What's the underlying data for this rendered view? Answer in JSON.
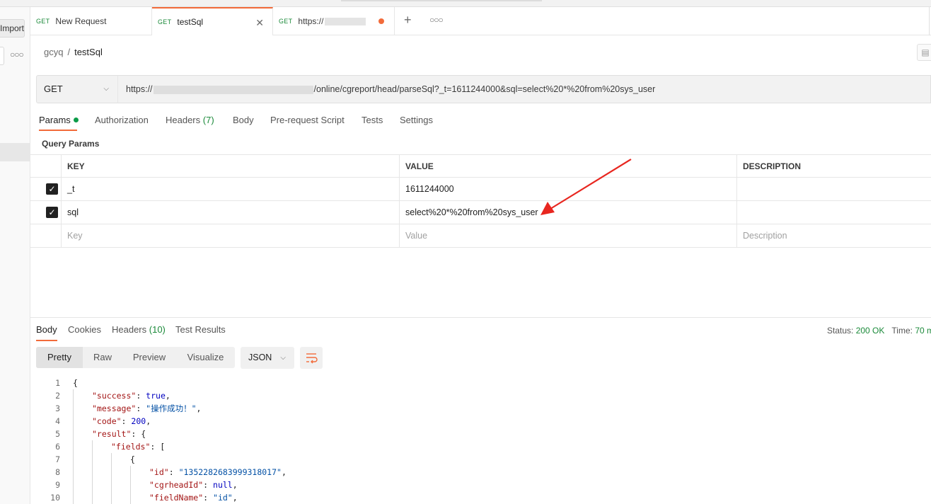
{
  "left_panel": {
    "import_label": "Import"
  },
  "tabs": [
    {
      "method": "GET",
      "label": "New Request"
    },
    {
      "method": "GET",
      "label": "testSql"
    },
    {
      "method": "GET",
      "label": "https://"
    }
  ],
  "breadcrumb": {
    "workspace": "gcyq",
    "separator": "/",
    "request": "testSql"
  },
  "request": {
    "method": "GET",
    "url_prefix": "https://",
    "url_suffix": "/online/cgreport/head/parseSql?_t=1611244000&sql=select%20*%20from%20sys_user"
  },
  "request_tabs": {
    "params": "Params",
    "authorization": "Authorization",
    "headers": "Headers",
    "headers_count": "(7)",
    "body": "Body",
    "pre_request": "Pre-request Script",
    "tests": "Tests",
    "settings": "Settings"
  },
  "query_params": {
    "title": "Query Params",
    "columns": {
      "key": "KEY",
      "value": "VALUE",
      "description": "DESCRIPTION"
    },
    "rows": [
      {
        "key": "_t",
        "value": "1611244000",
        "checked": true
      },
      {
        "key": "sql",
        "value": "select%20*%20from%20sys_user",
        "checked": true
      }
    ],
    "placeholders": {
      "key": "Key",
      "value": "Value",
      "description": "Description"
    }
  },
  "response_tabs": {
    "body": "Body",
    "cookies": "Cookies",
    "headers": "Headers",
    "headers_count": "(10)",
    "test_results": "Test Results"
  },
  "status": {
    "label": "Status:",
    "code": "200 OK",
    "time_label": "Time:",
    "time": "70 m"
  },
  "view_modes": [
    "Pretty",
    "Raw",
    "Preview",
    "Visualize"
  ],
  "format": "JSON",
  "code_lines": [
    {
      "n": "1",
      "indent": 0,
      "key": "",
      "sep": "",
      "value": "{",
      "vtype": "p",
      "tail": ""
    },
    {
      "n": "2",
      "indent": 1,
      "key": "\"success\"",
      "sep": ": ",
      "value": "true",
      "vtype": "kw",
      "tail": ","
    },
    {
      "n": "3",
      "indent": 1,
      "key": "\"message\"",
      "sep": ": ",
      "value": "\"操作成功！\"",
      "vtype": "s",
      "tail": ","
    },
    {
      "n": "4",
      "indent": 1,
      "key": "\"code\"",
      "sep": ": ",
      "value": "200",
      "vtype": "kw",
      "tail": ","
    },
    {
      "n": "5",
      "indent": 1,
      "key": "\"result\"",
      "sep": ": ",
      "value": "{",
      "vtype": "p",
      "tail": ""
    },
    {
      "n": "6",
      "indent": 2,
      "key": "\"fields\"",
      "sep": ": ",
      "value": "[",
      "vtype": "p",
      "tail": ""
    },
    {
      "n": "7",
      "indent": 3,
      "key": "",
      "sep": "",
      "value": "{",
      "vtype": "p",
      "tail": ""
    },
    {
      "n": "8",
      "indent": 4,
      "key": "\"id\"",
      "sep": ": ",
      "value": "\"1352282683999318017\"",
      "vtype": "s",
      "tail": ","
    },
    {
      "n": "9",
      "indent": 4,
      "key": "\"cgrheadId\"",
      "sep": ": ",
      "value": "null",
      "vtype": "kw",
      "tail": ","
    },
    {
      "n": "10",
      "indent": 4,
      "key": "\"fieldName\"",
      "sep": ": ",
      "value": "\"id\"",
      "vtype": "s",
      "tail": ","
    }
  ],
  "colors": {
    "accent": "#f26b3a",
    "get_method": "#1b8a3a",
    "status_ok": "#1b8a3a",
    "annotation_arrow": "#e8261f"
  }
}
